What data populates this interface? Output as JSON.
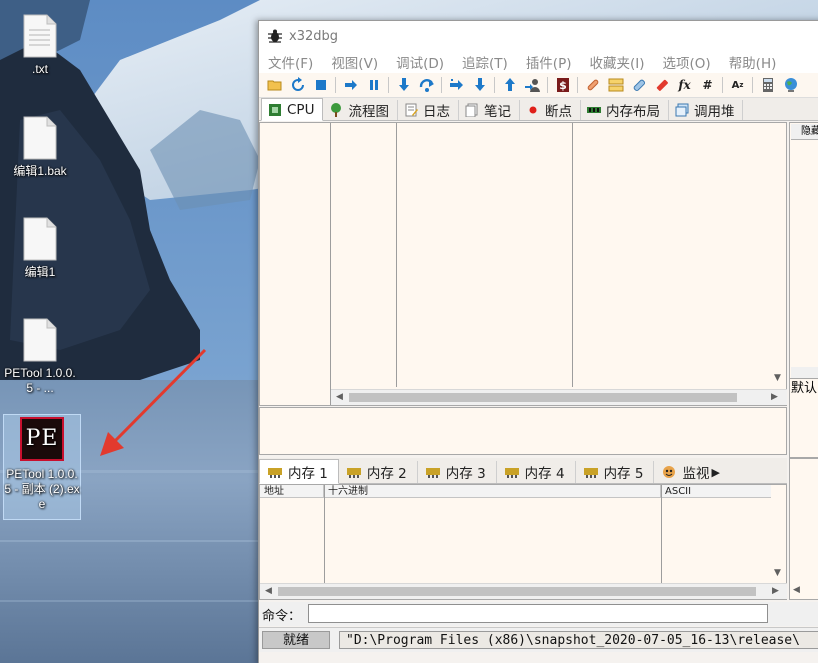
{
  "desktop": {
    "icons": [
      {
        "label": ".txt",
        "type": "file"
      },
      {
        "label": "编辑1.bak",
        "type": "file"
      },
      {
        "label": "编辑1",
        "type": "file"
      },
      {
        "label": "PETool 1.0.0.5 - ...",
        "type": "file"
      },
      {
        "label": "PETool 1.0.0.5 - 副本 (2).exe",
        "type": "pe-app",
        "logo_text": "PE",
        "selected": true
      }
    ],
    "annotation_color": "#e23a2e"
  },
  "window": {
    "title": "x32dbg",
    "menu": [
      "文件(F)",
      "视图(V)",
      "调试(D)",
      "追踪(T)",
      "插件(P)",
      "收藏夹(I)",
      "选项(O)",
      "帮助(H)"
    ],
    "toolbar_icons": [
      "open-icon",
      "restart-icon",
      "stop-icon",
      "run-icon",
      "pause-icon",
      "step-into-icon",
      "step-over-icon",
      "trace-into-icon",
      "trace-over-icon",
      "execute-till-return-icon",
      "run-to-user-code-icon",
      "script-icon",
      "patch-icon",
      "comment-icon",
      "label-icon",
      "bookmark-icon",
      "function-icon",
      "hash-icon",
      "font-size-icon",
      "calculator-icon",
      "globe-icon"
    ],
    "top_tabs": [
      {
        "label": "CPU",
        "icon": "cpu-icon",
        "active": true
      },
      {
        "label": "流程图",
        "icon": "tree-icon"
      },
      {
        "label": "日志",
        "icon": "log-icon"
      },
      {
        "label": "笔记",
        "icon": "notes-icon"
      },
      {
        "label": "断点",
        "icon": "breakpoint-icon"
      },
      {
        "label": "内存布局",
        "icon": "memory-map-icon"
      },
      {
        "label": "调用堆",
        "icon": "callstack-icon"
      }
    ],
    "register_pane": {
      "hide_label": "隐藏",
      "default_label": "默认"
    },
    "dump_tabs": [
      {
        "label": "内存 1",
        "active": true
      },
      {
        "label": "内存 2"
      },
      {
        "label": "内存 3"
      },
      {
        "label": "内存 4"
      },
      {
        "label": "内存 5"
      },
      {
        "label": "监视",
        "icon": "watch-icon"
      }
    ],
    "dump_columns": [
      "地址",
      "十六进制",
      "ASCII"
    ],
    "command_label": "命令：",
    "status": {
      "state": "就绪",
      "message": "\"D:\\Program Files (x86)\\snapshot_2020-07-05_16-13\\release\\"
    }
  }
}
